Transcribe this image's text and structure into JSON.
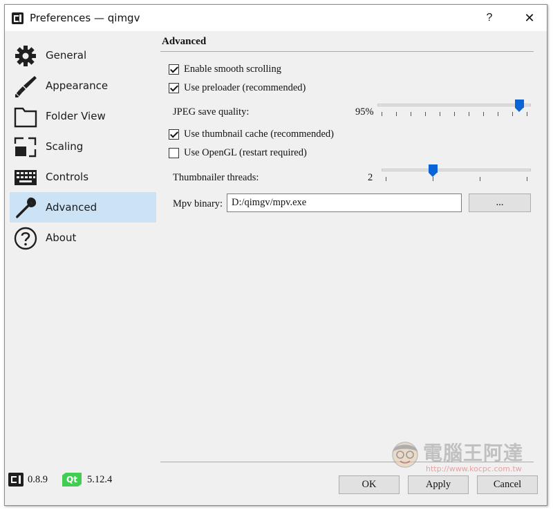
{
  "window": {
    "title": "Preferences — qimgv",
    "help_label": "?",
    "close_label": "✕"
  },
  "sidebar": {
    "items": [
      {
        "label": "General",
        "icon": "gear-icon"
      },
      {
        "label": "Appearance",
        "icon": "brush-icon"
      },
      {
        "label": "Folder View",
        "icon": "folder-icon"
      },
      {
        "label": "Scaling",
        "icon": "scaling-icon"
      },
      {
        "label": "Controls",
        "icon": "keyboard-icon"
      },
      {
        "label": "Advanced",
        "icon": "wrench-icon",
        "active": true
      },
      {
        "label": "About",
        "icon": "question-icon"
      }
    ]
  },
  "advanced": {
    "section_title": "Advanced",
    "smooth_scrolling": {
      "label": "Enable smooth scrolling",
      "checked": true
    },
    "preloader": {
      "label": "Use preloader (recommended)",
      "checked": true
    },
    "jpeg_quality": {
      "label": "JPEG save quality:",
      "value_text": "95%",
      "value": 95,
      "min": 0,
      "max": 100
    },
    "thumbnail_cache": {
      "label": "Use thumbnail cache (recommended)",
      "checked": true
    },
    "opengl": {
      "label": "Use OpenGL (restart required)",
      "checked": false
    },
    "thumbnailer_threads": {
      "label": "Thumbnailer threads:",
      "value_text": "2",
      "value": 2,
      "min": 1,
      "max": 4
    },
    "mpv_binary": {
      "label": "Mpv binary:",
      "value": "D:/qimgv/mpv.exe",
      "browse_label": "..."
    }
  },
  "footer": {
    "app_version": "0.8.9",
    "qt_logo_text": "Qt",
    "qt_version": "5.12.4",
    "ok_label": "OK",
    "apply_label": "Apply",
    "cancel_label": "Cancel"
  },
  "watermark": {
    "text": "電腦王阿達",
    "url": "http://www.kocpc.com.tw"
  },
  "colors": {
    "accent": "#0a64d8",
    "selection": "#cce3f6",
    "qt_green": "#41cd52"
  }
}
